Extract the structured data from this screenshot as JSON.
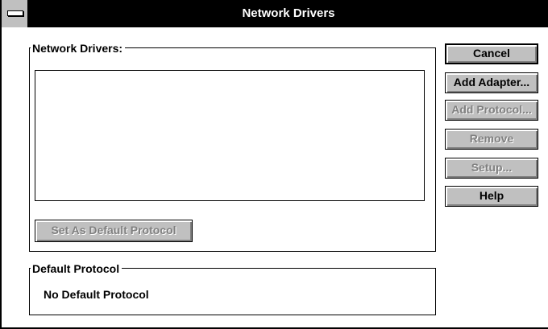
{
  "window": {
    "title": "Network Drivers",
    "system_menu_icon": "minus-bar-icon"
  },
  "drivers_group": {
    "label": "Network Drivers:",
    "items": [],
    "set_default_button": "Set As Default Protocol"
  },
  "default_group": {
    "label": "Default Protocol",
    "value": "No Default Protocol"
  },
  "buttons": {
    "cancel": "Cancel",
    "add_adapter": "Add Adapter...",
    "add_protocol": "Add Protocol...",
    "remove": "Remove",
    "setup": "Setup...",
    "help": "Help"
  },
  "colors": {
    "title_bar": "#000000",
    "button_face": "#c0c0c0",
    "disabled_text": "#808080"
  }
}
